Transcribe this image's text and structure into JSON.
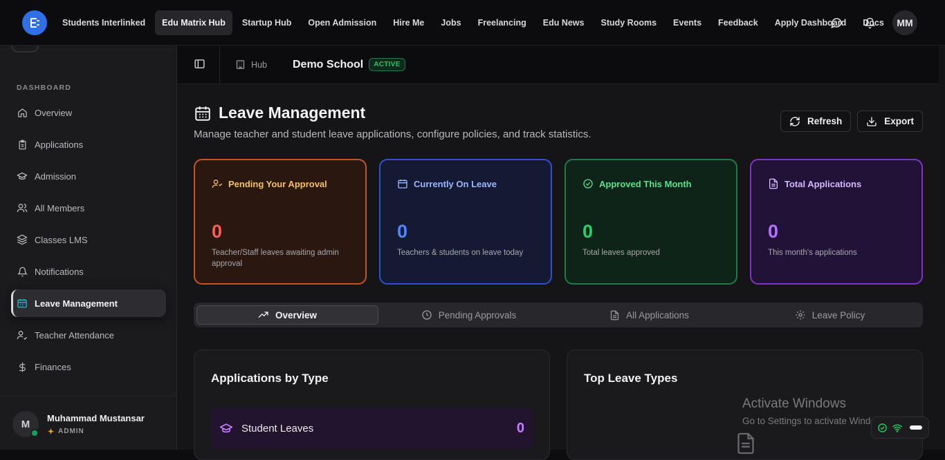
{
  "topnav": {
    "links": [
      "Students Interlinked",
      "Edu Matrix Hub",
      "Startup Hub",
      "Open Admission",
      "Hire Me",
      "Jobs",
      "Freelancing",
      "Edu News",
      "Study Rooms",
      "Events",
      "Feedback",
      "Apply Dashboard",
      "Docs"
    ],
    "active_link": "Edu Matrix Hub",
    "avatar_initials": "MM"
  },
  "sidebar": {
    "section_label": "DASHBOARD",
    "items": [
      {
        "label": "Overview",
        "icon": "home-icon"
      },
      {
        "label": "Applications",
        "icon": "clipboard-icon"
      },
      {
        "label": "Admission",
        "icon": "graduation-cap-icon"
      },
      {
        "label": "All Members",
        "icon": "users-icon"
      },
      {
        "label": "Classes LMS",
        "icon": "layers-icon"
      },
      {
        "label": "Notifications",
        "icon": "bell-icon"
      },
      {
        "label": "Leave Management",
        "icon": "calendar-icon"
      },
      {
        "label": "Teacher Attendance",
        "icon": "user-check-icon"
      },
      {
        "label": "Finances",
        "icon": "dollar-icon"
      }
    ],
    "active_item": "Leave Management",
    "user": {
      "initial": "M",
      "name": "Muhammad Mustansar",
      "role": "ADMIN"
    }
  },
  "subheader": {
    "crumb": "Hub",
    "school_name": "Demo School",
    "status_badge": "ACTIVE"
  },
  "page": {
    "title": "Leave Management",
    "description": "Manage teacher and student leave applications, configure policies, and track statistics.",
    "refresh_label": "Refresh",
    "export_label": "Export"
  },
  "stats": [
    {
      "title": "Pending Your Approval",
      "value": "0",
      "subtitle": "Teacher/Staff leaves awaiting admin approval",
      "color": "#c2571f",
      "icon": "user-clock-icon"
    },
    {
      "title": "Currently On Leave",
      "value": "0",
      "subtitle": "Teachers & students on leave today",
      "color": "#2f50d2",
      "icon": "calendar-icon"
    },
    {
      "title": "Approved This Month",
      "value": "0",
      "subtitle": "Total leaves approved",
      "color": "#1f7b4a",
      "icon": "check-circle-icon"
    },
    {
      "title": "Total Applications",
      "value": "0",
      "subtitle": "This month's applications",
      "color": "#8231c9",
      "icon": "file-text-icon"
    }
  ],
  "tabs": [
    {
      "label": "Overview",
      "icon": "trending-up-icon"
    },
    {
      "label": "Pending Approvals",
      "icon": "clock-icon"
    },
    {
      "label": "All Applications",
      "icon": "file-text-icon"
    },
    {
      "label": "Leave Policy",
      "icon": "gear-icon"
    }
  ],
  "active_tab": "Overview",
  "panels": {
    "by_type": {
      "title": "Applications by Type",
      "rows": [
        {
          "label": "Student Leaves",
          "count": "0",
          "icon": "graduation-cap-icon"
        }
      ]
    },
    "top_types": {
      "title": "Top Leave Types"
    }
  },
  "watermark": {
    "line1": "Activate Windows",
    "line2": "Go to Settings to activate Windows."
  }
}
